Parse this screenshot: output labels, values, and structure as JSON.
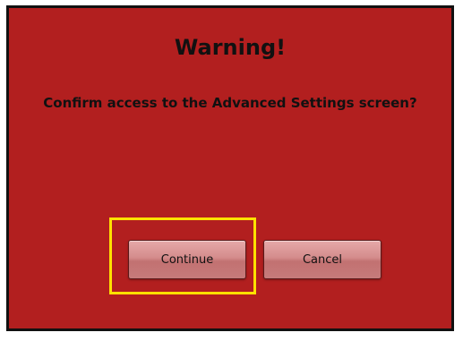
{
  "dialog": {
    "title": "Warning!",
    "message": "Confirm access to the Advanced Settings screen?",
    "buttons": {
      "continue_label": "Continue",
      "cancel_label": "Cancel"
    }
  },
  "colors": {
    "background": "#b21f1f",
    "highlight": "#ffe100",
    "text": "#111111"
  }
}
